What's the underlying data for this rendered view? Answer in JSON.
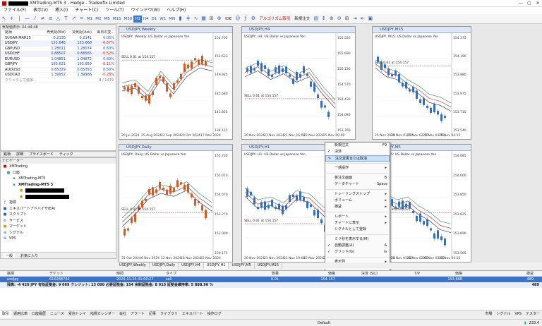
{
  "title": "XMTrading-MT5 3 - Hedge - Tradexfix Limited",
  "menu": [
    "ファイル(F)",
    "表示(V)",
    "挿入(I)",
    "チャート(C)",
    "ツール(T)",
    "ウインドウ(W)",
    "ヘルプ(H)"
  ],
  "timeframes": [
    "M1",
    "M2",
    "M5",
    "M15",
    "M30",
    "H1",
    "H4",
    "D1",
    "W1",
    "MN"
  ],
  "toolbar": {
    "ide": "IDE",
    "algo": "アルゴリズム取引",
    "neworder": "新規注文"
  },
  "marketwatch": {
    "header": "気配値表示: 04:44:48",
    "cols": [
      "銘柄",
      "売気配(Bid)",
      "買気配(Ask)",
      "毎日の変..."
    ],
    "rows": [
      {
        "s": "SUGAR-MAR25",
        "b": "0.2135",
        "a": "0.2141",
        "c": "0.05%",
        "n": false
      },
      {
        "s": "USDJPY",
        "b": "153.645",
        "a": "153.668",
        "c": "-0.67%",
        "n": true
      },
      {
        "s": "GBPUSD",
        "b": "1.28011",
        "a": "1.28074",
        "c": "0.60%",
        "n": false
      },
      {
        "s": "USDCHF",
        "b": "0.88507",
        "a": "0.88565",
        "c": "-0.52%",
        "n": true
      },
      {
        "s": "EURUSD",
        "b": "1.04851",
        "a": "1.04872",
        "c": "0.69%",
        "n": false
      },
      {
        "s": "GBPJPY",
        "b": "193.621",
        "a": "193.659",
        "c": "-0.11%",
        "n": true
      },
      {
        "s": "AUDUSD",
        "b": "0.65329",
        "a": "0.65353",
        "c": "0.50%",
        "n": false
      },
      {
        "s": "USDCAD",
        "b": "1.39952",
        "a": "1.39986",
        "c": "-0.28%",
        "n": true
      }
    ],
    "add": "クリックして追加...",
    "count": "8 / 1479"
  },
  "mwtabs": [
    "銘柄",
    "詳細",
    "プライスボード",
    "ティック"
  ],
  "nav": {
    "title": "ナビゲーター",
    "items": [
      "XMTrading",
      "口座",
      "XMTrading-MT5",
      "XMTrading-MT5 3",
      "指標",
      "エキスパートアドバイザ(EA)",
      "スクリプト",
      "サービス",
      "マーケット",
      "シグナル",
      "VPS"
    ],
    "tabs": [
      "一般",
      "お気に入り"
    ]
  },
  "charts": [
    {
      "title": "USDJPY,Weekly",
      "sym": "USDJPY, Weekly: US Dollar vs Japanese Yen",
      "prices": [
        "154.705",
        "153.633",
        "149.925",
        "145.680",
        "141.855",
        "138.115"
      ],
      "dates": [
        "20 Jul 2024",
        "25 Aug 2024",
        "22 Sep 2024",
        "20 Oct 2024",
        "17 Nov 2024"
      ]
    },
    {
      "title": "USDJPY,H4",
      "sym": "USDJPY, H4: US Dollar vs Japanese Yen",
      "prices": [
        "155.520",
        "155.690",
        "155.130",
        "154.570",
        "154.430",
        "154.080",
        "153.760"
      ],
      "dates": [
        "20 Nov 2024",
        "21 Nov 2024",
        "21 Nov 16:00",
        "22 Nov 2024",
        "25 Nov 00:00"
      ]
    },
    {
      "title": "USDJPY,M15",
      "sym": "USDJPY, M15: US Dollar vs Japanese Yen",
      "prices": [
        "154.375",
        "154.190",
        "153.880",
        "153.975",
        "153.710",
        "153.540"
      ],
      "dates": [
        "25 Nov 2024",
        "25 Nov 01:15",
        "25 Nov 02:15",
        "25 Nov 03:15",
        "25 Nov 04:15"
      ]
    },
    {
      "title": "USDJPY,Daily",
      "sym": "USDJPY, Daily: US Dollar vs Japanese Yen",
      "prices": [
        "155.730",
        "155.010",
        "154.070",
        "153.270",
        "152.000",
        "150.175"
      ],
      "dates": [
        "31 Oct 2024",
        "6 Nov 2024",
        "12 Nov 2024",
        "18 Nov 2024",
        "22 Nov 2024"
      ]
    },
    {
      "title": "USDJPY,H1",
      "sym": "USDJPY, H1: US Dollar vs Japanese Yen",
      "prices": [],
      "dates": [
        "20 Nov 2024",
        "21 Nov 2024",
        "21 Nov 19:00",
        "22 Nov 2024",
        "25 Nov 2024"
      ]
    },
    {
      "title": "USDJPY,M5",
      "sym": "USDJPY, M5: US Dollar vs Japanese Yen",
      "prices": [
        "154.085",
        "154.000",
        "153.850",
        "153.825",
        "153.690",
        "153.565"
      ],
      "dates": [
        "25 Nov 2024",
        "25 Nov 01:05",
        "25 Nov 02:05",
        "25 Nov 03:05",
        "25 Nov 04:05"
      ]
    }
  ],
  "sellLabel": "SELL 0.01 at 154.157",
  "context": [
    {
      "l": "新規注文",
      "s": "F9",
      "i": "",
      "sep": false
    },
    {
      "l": "決済",
      "s": "",
      "i": "✓",
      "sep": false
    },
    {
      "l": "注文変更または取消",
      "s": "",
      "i": "✎",
      "sep": true,
      "sel": true
    },
    {
      "l": "一括操作",
      "s": "▸",
      "i": "",
      "sep": true
    },
    {
      "l": "板注文画面",
      "s": "B",
      "i": "",
      "sep": false
    },
    {
      "l": "データチャート",
      "s": "Space",
      "i": "",
      "sep": true
    },
    {
      "l": "トレーリングストップ",
      "s": "▸",
      "i": "",
      "sep": false
    },
    {
      "l": "ボリューム",
      "s": "▸",
      "i": "",
      "sep": false
    },
    {
      "l": "損益",
      "s": "▸",
      "i": "",
      "sep": true
    },
    {
      "l": "レポート",
      "s": "▸",
      "i": "",
      "sep": false
    },
    {
      "l": "チャートに表示",
      "s": "▸",
      "i": "",
      "sep": false
    },
    {
      "l": "シグナルとして登録",
      "s": "",
      "i": "",
      "sep": true
    },
    {
      "l": "ミリ秒を表示する(M)",
      "s": "",
      "i": "",
      "sep": false
    },
    {
      "l": "自動調整(A)",
      "s": "A",
      "i": "✓",
      "sep": false
    },
    {
      "l": "グリッド(G)",
      "s": "G",
      "i": "✓",
      "sep": true
    },
    {
      "l": "表示列",
      "s": "▸",
      "i": "",
      "sep": false
    }
  ],
  "charttabs": [
    "USDJPY,Weekly",
    "USDJPY,Daily",
    "USDJPY,H4",
    "USDJPY,H1",
    "USDJPY,M5",
    "USDJPY,M15"
  ],
  "trade": {
    "cols": [
      "銘柄",
      "チケット",
      "時間",
      "タイプ",
      "数量",
      "価格",
      "決済 (S/L)",
      "T/P",
      "価格",
      "損益"
    ],
    "row": [
      "usdjpy",
      "610288742",
      "2024.11.25 01:00:27",
      "sell",
      "0.01",
      "154.157",
      "",
      "",
      "153.668",
      "489"
    ],
    "balance": "残高: -4 420 JPY  有効証拠金: 9 069  クレジット: 13 000  必要証拠金: 154  余剰証拠金: 8 915  証拠金維持率: 5 888.96 %",
    "total": "489"
  },
  "bottabs": [
    "取引",
    "運用比率",
    "口座履歴",
    "ニュース",
    "受信トレイ",
    "指標カレンダー",
    "会社",
    "アラート",
    "記事",
    "ライブラリ",
    "エキスパート",
    "操作ログ"
  ],
  "bottomRight": [
    "市場",
    "シグナル",
    "VPS",
    "テスター"
  ],
  "status": {
    "profile": "Default",
    "conn": "233.4"
  }
}
